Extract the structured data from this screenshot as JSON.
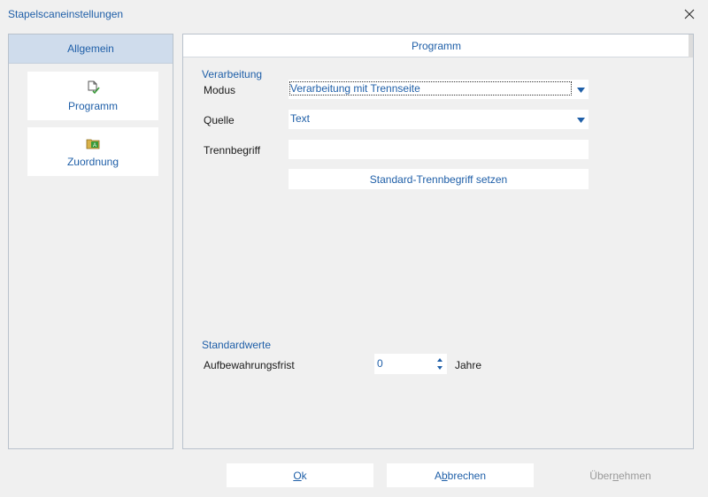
{
  "window": {
    "title": "Stapelscaneinstellungen"
  },
  "nav": {
    "header": "Allgemein",
    "items": [
      {
        "label": "Programm",
        "icon": "document-check-icon"
      },
      {
        "label": "Zuordnung",
        "icon": "folder-assign-icon"
      }
    ]
  },
  "content": {
    "tab_title": "Programm",
    "verarbeitung": {
      "section_title": "Verarbeitung",
      "modus_label": "Modus",
      "modus_value": "Verarbeitung mit Trennseite",
      "quelle_label": "Quelle",
      "quelle_value": "Text",
      "trennbegriff_label": "Trennbegriff",
      "trennbegriff_value": "",
      "set_default_button": "Standard-Trennbegriff setzen"
    },
    "standardwerte": {
      "section_title": "Standardwerte",
      "retention_label": "Aufbewahrungsfrist",
      "retention_value": "0",
      "retention_unit": "Jahre"
    }
  },
  "footer": {
    "ok": {
      "pre": "",
      "u": "O",
      "post": "k"
    },
    "cancel": {
      "pre": "A",
      "u": "b",
      "post": "brechen"
    },
    "apply": {
      "pre": "Über",
      "u": "n",
      "post": "ehmen"
    }
  },
  "colors": {
    "accent": "#1f5fa8",
    "nav_header_bg": "#cfdcec",
    "background": "#f0f0f0",
    "disabled_text": "#9a9a9a"
  }
}
